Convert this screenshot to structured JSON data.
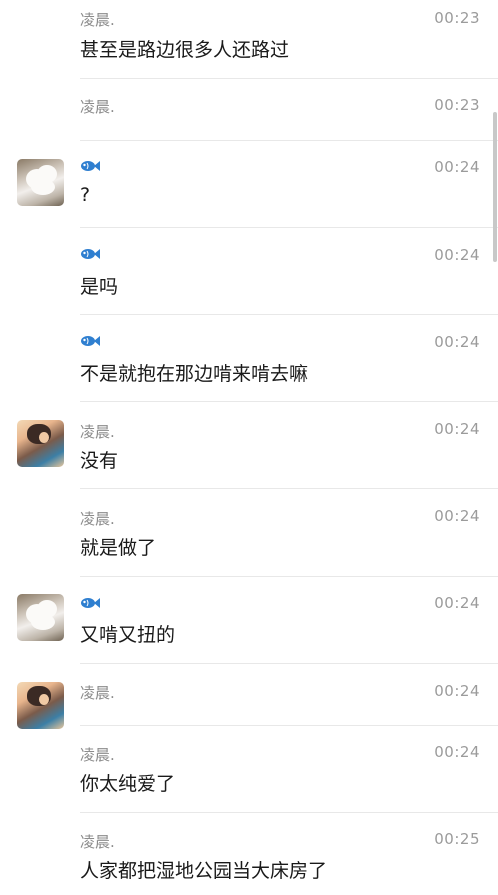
{
  "messages": [
    {
      "sender": "凌晨.",
      "time": "00:23",
      "text": "甚至是路边很多人还路过",
      "avatar": "none"
    },
    {
      "sender": "凌晨.",
      "time": "00:23",
      "text": "",
      "avatar": "none"
    },
    {
      "sender": "fish-icon",
      "time": "00:24",
      "text": "?",
      "avatar": "flower"
    },
    {
      "sender": "fish-icon",
      "time": "00:24",
      "text": "是吗",
      "avatar": "none"
    },
    {
      "sender": "fish-icon",
      "time": "00:24",
      "text": "不是就抱在那边啃来啃去嘛",
      "avatar": "none"
    },
    {
      "sender": "凌晨.",
      "time": "00:24",
      "text": "没有",
      "avatar": "girl"
    },
    {
      "sender": "凌晨.",
      "time": "00:24",
      "text": "就是做了",
      "avatar": "none"
    },
    {
      "sender": "fish-icon",
      "time": "00:24",
      "text": "又啃又扭的",
      "avatar": "flower"
    },
    {
      "sender": "凌晨.",
      "time": "00:24",
      "text": "",
      "avatar": "girl"
    },
    {
      "sender": "凌晨.",
      "time": "00:24",
      "text": "你太纯爱了",
      "avatar": "none"
    },
    {
      "sender": "凌晨.",
      "time": "00:25",
      "text": "人家都把湿地公园当大床房了",
      "avatar": "none"
    }
  ],
  "colors": {
    "background": "#ffffff",
    "name": "#8c8c8c",
    "time": "#9b9b9b",
    "text": "#1a1a1a",
    "divider": "#e8e8e8",
    "fish": "#2f7fd0"
  }
}
